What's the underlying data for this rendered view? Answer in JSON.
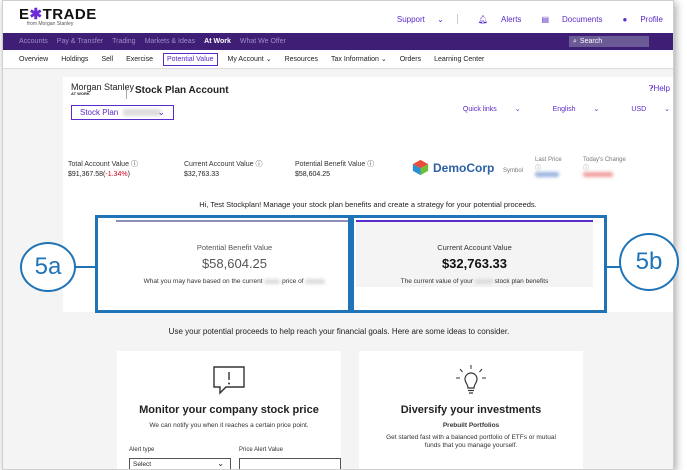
{
  "header": {
    "logo_main": "E*TRADE",
    "logo_sub": "from Morgan Stanley",
    "support": "Support",
    "alerts": "Alerts",
    "documents": "Documents",
    "profile": "Profile"
  },
  "nav": {
    "items": [
      "Accounts",
      "Pay & Transfer",
      "Trading",
      "Markets & Ideas",
      "At Work",
      "What We Offer"
    ],
    "active_index": 4,
    "search_placeholder": "Search"
  },
  "subnav": {
    "items": [
      "Overview",
      "Holdings",
      "Sell",
      "Exercise",
      "Potential Value",
      "My Account",
      "Resources",
      "Tax Information",
      "Orders",
      "Learning Center"
    ],
    "active_index": 4
  },
  "account": {
    "ms_logo": "Morgan Stanley",
    "ms_logo_sub": "AT WORK",
    "title": "Stock Plan Account",
    "help": "Help",
    "stock_plan_label": "Stock Plan",
    "quick_links": "Quick links",
    "language": "English",
    "currency": "USD"
  },
  "stats": {
    "total_label": "Total Account Value",
    "total_value": "$91,367.58",
    "total_change": "-1.34%",
    "current_label": "Current Account Value",
    "current_value": "$32,763.33",
    "potential_label": "Potential Benefit Value",
    "potential_value": "$58,604.25",
    "company": "DemoCorp",
    "symbol_label": "Symbol",
    "last_price_label": "Last Price",
    "todays_change_label": "Today's Change"
  },
  "greeting": "Hi, Test Stockplan! Manage your stock plan benefits and create a strategy for your potential proceeds.",
  "potential_box": {
    "label": "Potential Benefit Value",
    "amount": "$58,604.25",
    "desc_a": "What you may have based on the current",
    "desc_b": "price of"
  },
  "current_box": {
    "label": "Current Account Value",
    "amount": "$32,763.33",
    "desc_a": "The current value of your",
    "desc_b": "stock plan benefits"
  },
  "annotations": {
    "left": "5a",
    "right": "5b"
  },
  "ideas": {
    "title": "Use your potential proceeds to help reach your financial goals. Here are some ideas to consider.",
    "monitor": {
      "title": "Monitor your company stock price",
      "desc": "We can notify you when it reaches a certain price point.",
      "alert_type_label": "Alert type",
      "alert_type_value": "Select",
      "price_alert_label": "Price Alert Value"
    },
    "diversify": {
      "title": "Diversify your investments",
      "subtitle": "Prebuilt Portfolios",
      "desc": "Get started fast with a balanced portfolio of ETFs or mutual funds that you manage yourself."
    }
  },
  "colors": {
    "brand_purple": "#5a2bc9",
    "nav_bg": "#3f1f76",
    "annotation_blue": "#1f73b7",
    "negative_red": "#d0021b"
  }
}
